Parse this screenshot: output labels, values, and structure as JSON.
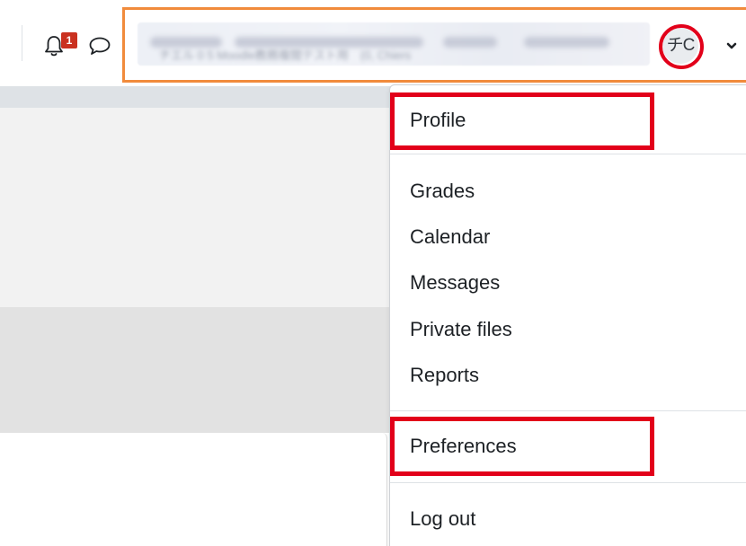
{
  "navbar": {
    "notifications": {
      "icon": "bell-icon",
      "count": "1",
      "badge_color": "#ca3120"
    },
    "messages": {
      "icon": "chat-icon"
    },
    "user": {
      "name_blurred": "チエル 0 5 Moodle教務複閲テスト用　(0, Chiers",
      "avatar_initials": "チC",
      "caret_icon": "chevron-down-icon"
    },
    "highlight_color": "#f18b3c"
  },
  "menu": {
    "items": [
      {
        "label": "Profile"
      },
      {
        "label": "Grades"
      },
      {
        "label": "Calendar"
      },
      {
        "label": "Messages"
      },
      {
        "label": "Private files"
      },
      {
        "label": "Reports"
      },
      {
        "label": "Preferences"
      },
      {
        "label": "Log out"
      }
    ],
    "highlight_color": "#e2001a"
  }
}
